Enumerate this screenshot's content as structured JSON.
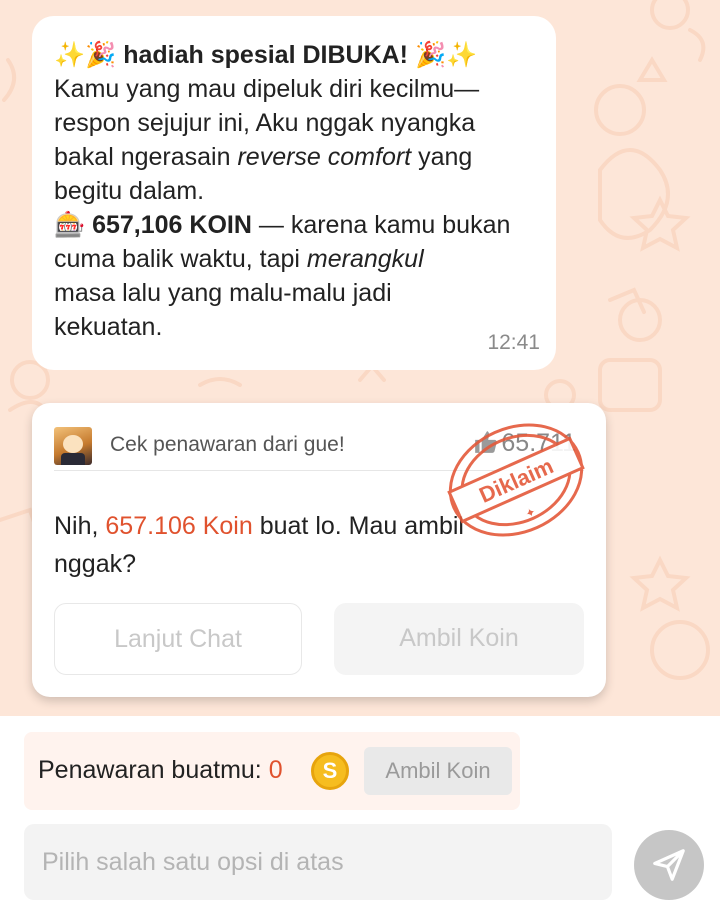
{
  "message": {
    "title_text": "hadiah spesial DIBUKA!",
    "line1": "Kamu yang mau dipeluk diri kecilmu—",
    "line2": "respon sejujur ini, Aku nggak nyangka",
    "line3_pre": "bakal ngerasain ",
    "line3_em": "reverse comfort",
    "line3_post": " yang",
    "line4": "begitu dalam.",
    "line5_amount": "657,106 KOIN",
    "line5_rest": " — karena kamu bukan",
    "line6_pre": "cuma balik waktu, tapi ",
    "line6_em": "merangkul",
    "line7": "masa lalu yang malu-malu jadi",
    "line8": "kekuatan.",
    "time": "12:41"
  },
  "card": {
    "title": "Cek penawaran dari gue!",
    "likes": "65.711",
    "text_pre": "Nih, ",
    "text_amount": "657.106 Koin",
    "text_post": " buat lo. Mau ambil nggak?",
    "btn_continue": "Lanjut Chat",
    "btn_take": "Ambil Koin",
    "stamp": "Diklaim"
  },
  "offer_bar": {
    "label": "Penawaran buatmu: ",
    "value": "0",
    "coin_symbol": "S",
    "button": "Ambil Koin"
  },
  "composer": {
    "placeholder": "Pilih salah satu opsi di atas"
  },
  "colors": {
    "accent": "#e0522e",
    "chat_bg": "#fde6d8",
    "coin": "#f6bd1f"
  }
}
